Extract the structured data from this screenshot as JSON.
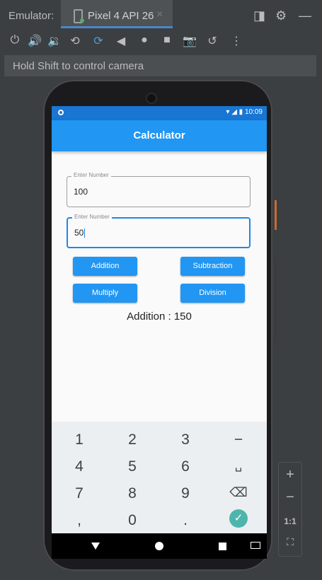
{
  "window": {
    "emulator_label": "Emulator:",
    "tab_title": "Pixel 4 API 26",
    "tab_close": "×"
  },
  "toolbar_icons": [
    "power-icon",
    "volume-up-icon",
    "volume-down-icon",
    "rotate-left-icon",
    "rotate-right-icon",
    "back-icon",
    "home-icon",
    "overview-icon",
    "camera-icon",
    "snapshot-icon",
    "more-icon"
  ],
  "hint": "Hold Shift to control camera",
  "status_bar": {
    "time": "10:09"
  },
  "app": {
    "title": "Calculator",
    "field1": {
      "label": "Enter Number",
      "value": "100"
    },
    "field2": {
      "label": "Enter Number",
      "value": "50"
    },
    "buttons": {
      "addition": "Addition",
      "subtraction": "Subtraction",
      "multiply": "Multiply",
      "division": "Division"
    },
    "result": "Addition : 150"
  },
  "keyboard": {
    "rows": [
      [
        "1",
        "2",
        "3",
        "−"
      ],
      [
        "4",
        "5",
        "6",
        "␣"
      ],
      [
        "7",
        "8",
        "9",
        "⌫"
      ],
      [
        ",",
        "0",
        ".",
        "✓"
      ]
    ]
  },
  "zoom_controls": {
    "plus": "+",
    "minus": "−",
    "ratio": "1:1"
  },
  "colors": {
    "primary": "#2196f3",
    "status": "#1976d2",
    "done_key": "#4db6ac"
  }
}
